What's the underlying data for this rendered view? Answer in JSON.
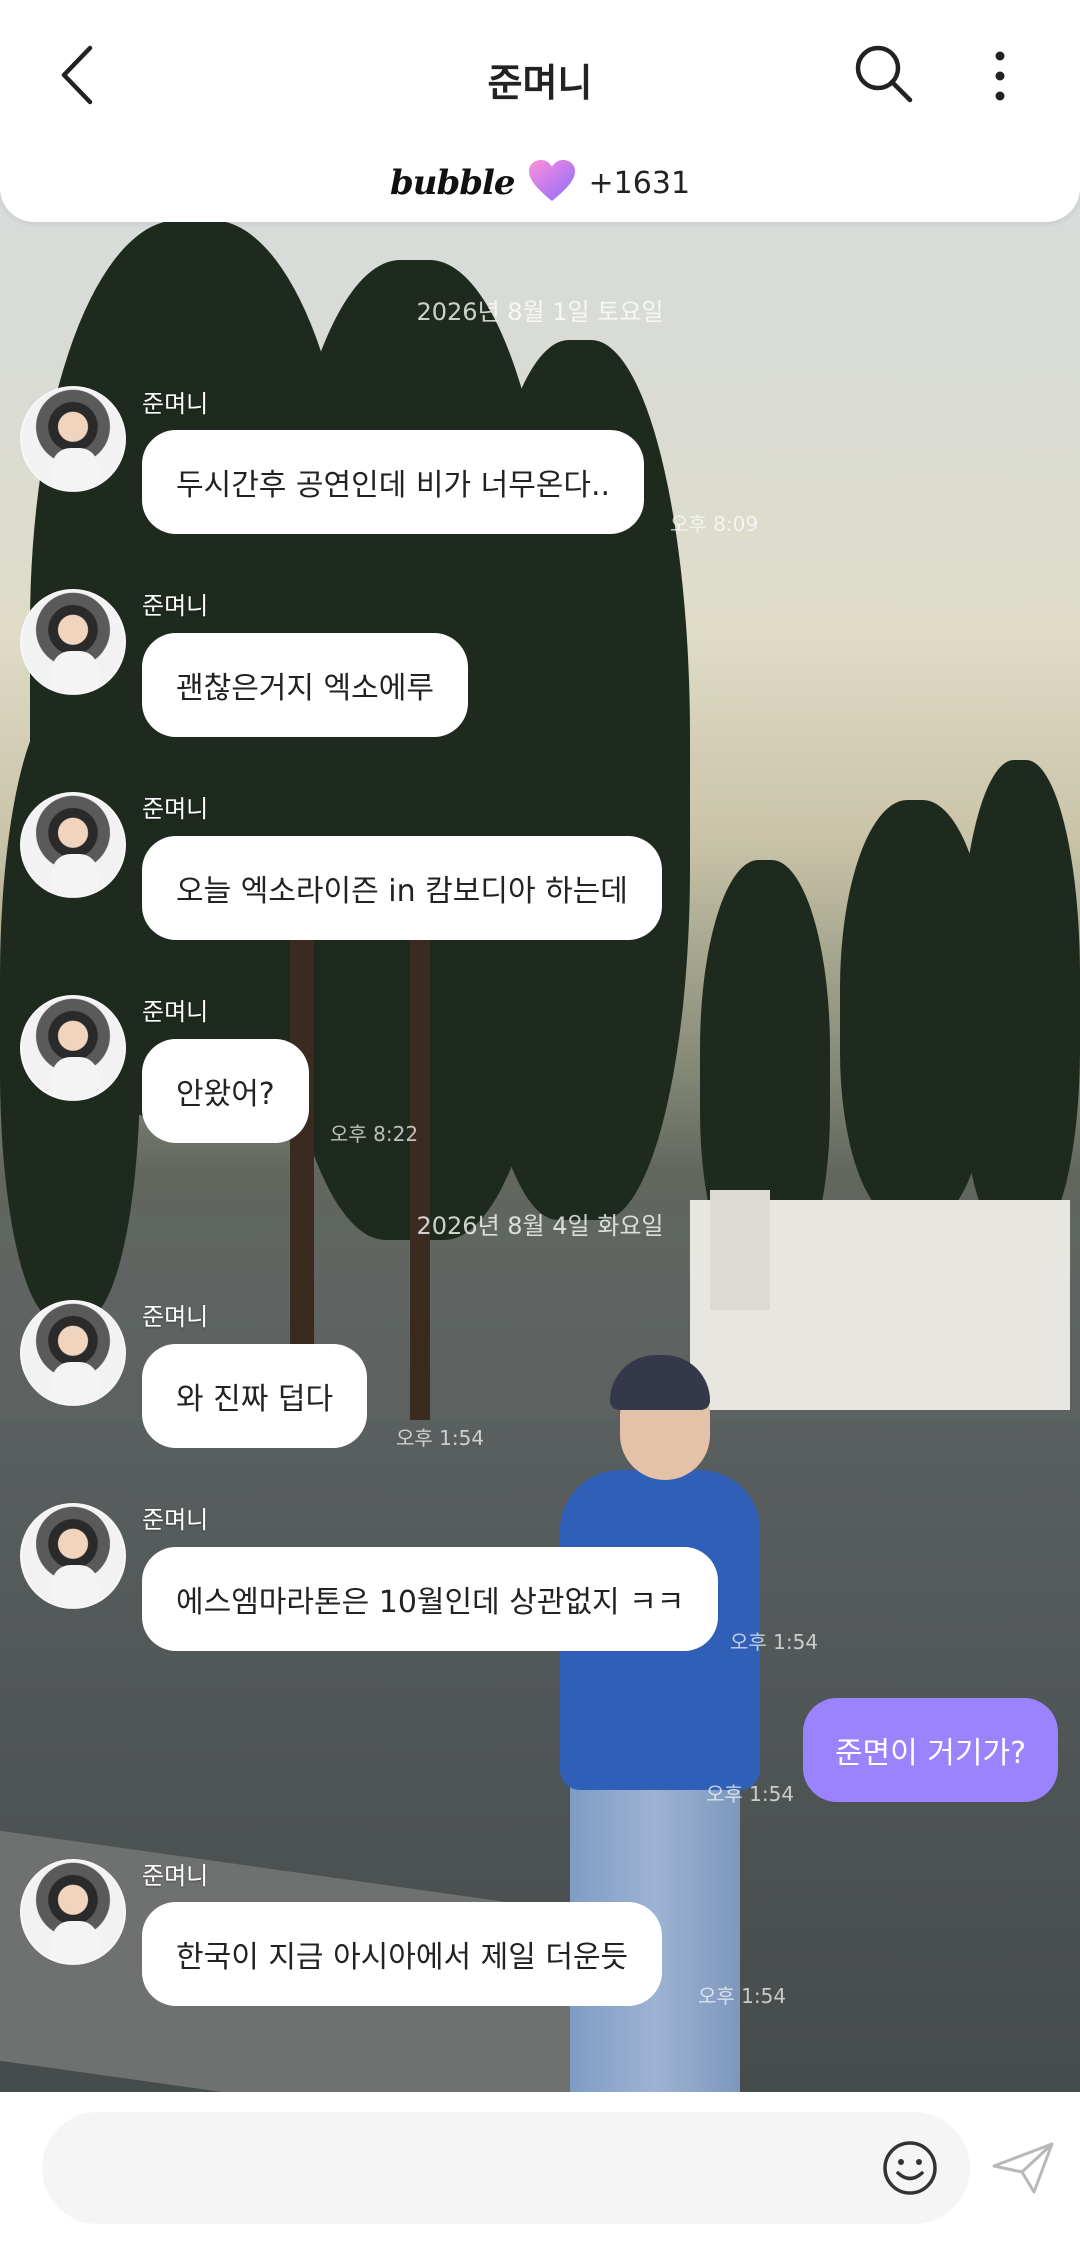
{
  "header": {
    "title": "준며니",
    "bubble_logo": "bubble",
    "bubble_count": "+1631",
    "icons": [
      "back-arrow-icon",
      "search-icon",
      "more-vertical-icon",
      "heart-icon"
    ]
  },
  "chat": {
    "dates": {
      "first": "2026년 8월 1일 토요일",
      "second": "2026년 8월 4일 화요일"
    },
    "messages": [
      {
        "sender": "준며니",
        "text": "두시간후 공연인데 비가 너무온다..",
        "time": "오후 8:09"
      },
      {
        "sender": "준며니",
        "text": "괜찮은거지 엑소에루",
        "time": ""
      },
      {
        "sender": "준며니",
        "text": "오늘 엑소라이즌 in 캄보디아 하는데",
        "time": ""
      },
      {
        "sender": "준며니",
        "text": "안왔어?",
        "time": "오후 8:22"
      },
      {
        "sender": "준며니",
        "text": "와 진짜 덥다",
        "time": "오후 1:54"
      },
      {
        "sender": "준며니",
        "text": "에스엠마라톤은 10월인데 상관없지 ㅋㅋ",
        "time": "오후 1:54"
      },
      {
        "sender": "",
        "text": "준면이 거기가?",
        "time": "오후 1:54",
        "outgoing": true
      },
      {
        "sender": "준며니",
        "text": "한국이 지금 아시아에서 제일 더운듯",
        "time": "오후 1:54"
      }
    ]
  },
  "input": {
    "placeholder": ""
  },
  "colors": {
    "outgoing_bubble": "#9b83ff",
    "incoming_bubble": "#ffffff",
    "header_bg": "#ffffff"
  }
}
